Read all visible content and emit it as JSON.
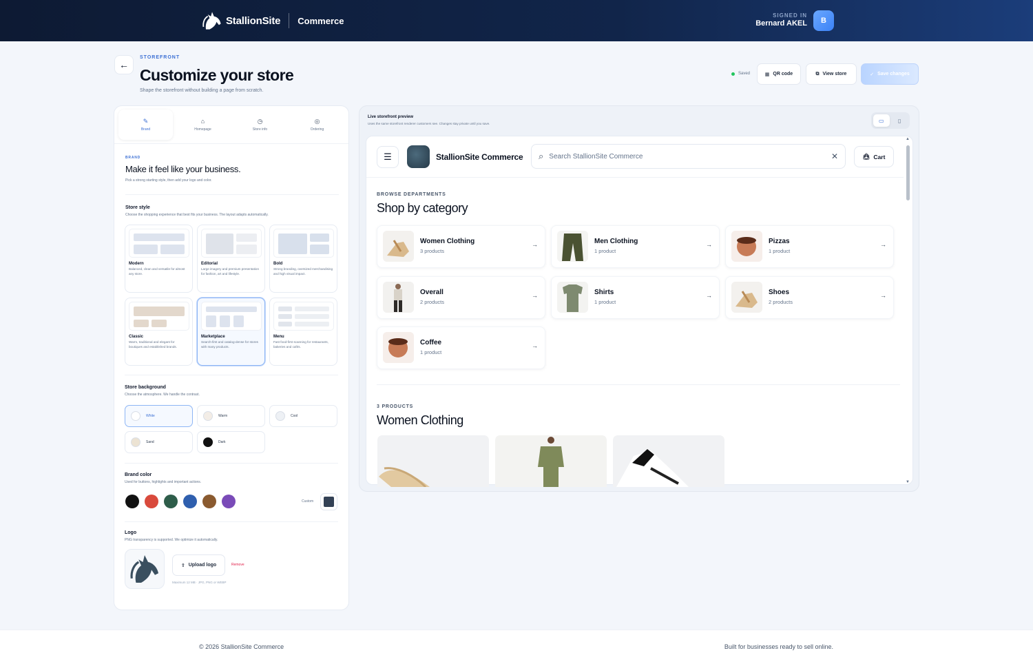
{
  "header": {
    "brand_name": "StallionSite",
    "brand_sub": "Commerce",
    "signed_in_label": "SIGNED IN",
    "user_name": "Bernard AKEL",
    "avatar_initial": "B"
  },
  "page": {
    "eyebrow": "STOREFRONT",
    "title": "Customize your store",
    "subtitle": "Shape the storefront without building a page from scratch.",
    "saved_status": "Saved",
    "qr_label": "QR code",
    "view_label": "View store",
    "save_label": "Save changes"
  },
  "tabs": [
    {
      "label": "Brand",
      "icon": "✎"
    },
    {
      "label": "Homepage",
      "icon": "⌂"
    },
    {
      "label": "Store info",
      "icon": "◷"
    },
    {
      "label": "Ordering",
      "icon": "◎"
    }
  ],
  "brand_section": {
    "eyebrow": "BRAND",
    "title": "Make it feel like your business.",
    "desc": "Pick a strong starting style, then add your logo and color."
  },
  "store_style": {
    "title": "Store style",
    "desc": "Choose the shopping experience that best fits your business. The layout adapts automatically.",
    "options": [
      {
        "name": "Modern",
        "desc": "Balanced, clean and versatile for almost any store."
      },
      {
        "name": "Editorial",
        "desc": "Large imagery and premium presentation for fashion, art and lifestyle."
      },
      {
        "name": "Bold",
        "desc": "Strong branding, oversized merchandising and high visual impact."
      },
      {
        "name": "Classic",
        "desc": "Warm, traditional and elegant for boutiques and established brands."
      },
      {
        "name": "Marketplace",
        "desc": "Search-first and catalog-dense for stores with many products."
      },
      {
        "name": "Menu",
        "desc": "Fast food-first scanning for restaurants, bakeries and cafés."
      }
    ],
    "selected": "Marketplace"
  },
  "store_background": {
    "title": "Store background",
    "desc": "Choose the atmosphere. We handle the contrast.",
    "options": [
      {
        "name": "White",
        "color": "#ffffff"
      },
      {
        "name": "Warm",
        "color": "#f3ede6"
      },
      {
        "name": "Cool",
        "color": "#eef1f5"
      },
      {
        "name": "Sand",
        "color": "#ece3d3"
      },
      {
        "name": "Dark",
        "color": "#111111"
      }
    ],
    "selected": "White"
  },
  "brand_color": {
    "title": "Brand color",
    "desc": "Used for buttons, highlights and important actions.",
    "colors": [
      "#111111",
      "#d94a3c",
      "#2e5d4a",
      "#2f5fae",
      "#8a5a2f",
      "#7a4bb8"
    ],
    "custom_label": "Custom",
    "custom_color": "#334155"
  },
  "logo": {
    "title": "Logo",
    "desc": "PNG transparency is supported. We optimize it automatically.",
    "upload_label": "Upload logo",
    "remove_label": "Remove",
    "hint": "Maximum 12 MB · JPG, PNG or WEBP"
  },
  "preview": {
    "title": "Live storefront preview",
    "desc": "Uses the same storefront renderer customers see. Changes stay private until you save.",
    "store_name": "StallionSite Commerce",
    "search_placeholder": "Search StallionSite Commerce",
    "cart_label": "Cart",
    "browse_eyebrow": "BROWSE DEPARTMENTS",
    "browse_title": "Shop by category",
    "categories": [
      {
        "name": "Women Clothing",
        "count": "3 products"
      },
      {
        "name": "Men Clothing",
        "count": "1 product"
      },
      {
        "name": "Pizzas",
        "count": "1 product"
      },
      {
        "name": "Overall",
        "count": "2 products"
      },
      {
        "name": "Shirts",
        "count": "1 product"
      },
      {
        "name": "Shoes",
        "count": "2 products"
      },
      {
        "name": "Coffee",
        "count": "1 product"
      }
    ],
    "products_eyebrow": "3 PRODUCTS",
    "products_title": "Women Clothing"
  },
  "footer": {
    "copyright": "© 2026 StallionSite Commerce",
    "tagline": "Built for businesses ready to sell online."
  }
}
